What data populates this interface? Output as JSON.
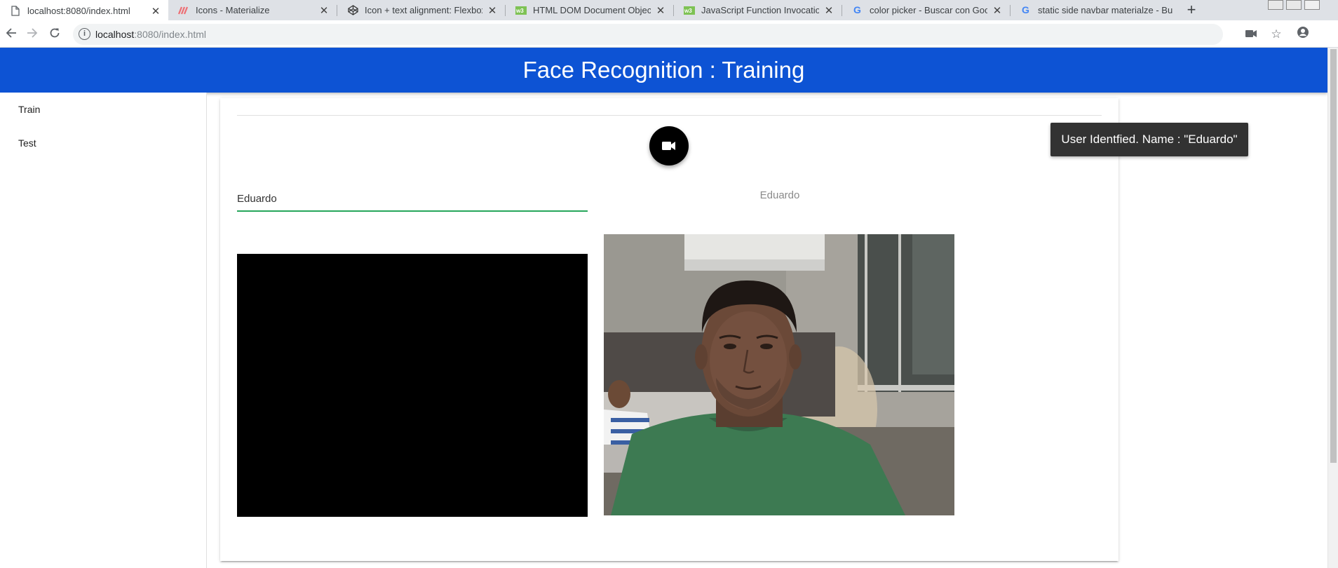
{
  "browser": {
    "tabs": [
      {
        "title": "localhost:8080/index.html",
        "icon": "page-icon",
        "active": true
      },
      {
        "title": "Icons - Materialize",
        "icon": "materialize-icon",
        "active": false
      },
      {
        "title": "Icon + text alignment: Flexbox",
        "icon": "codepen-icon",
        "active": false
      },
      {
        "title": "HTML DOM Document Objects",
        "icon": "w3schools-icon",
        "active": false
      },
      {
        "title": "JavaScript Function Invocation",
        "icon": "w3schools-icon",
        "active": false
      },
      {
        "title": "color picker - Buscar con Google",
        "icon": "google-icon",
        "active": false
      },
      {
        "title": "static side navbar materialze - Bu",
        "icon": "google-icon",
        "active": false
      }
    ],
    "url_host": "localhost",
    "url_rest": ":8080/index.html",
    "colors": {
      "tabstrip": "#dee1e6",
      "omnibox": "#f1f3f4"
    }
  },
  "page": {
    "title": "Face Recognition : Training",
    "nav_items": [
      {
        "label": "Train"
      },
      {
        "label": "Test"
      }
    ],
    "name_input_value": "Eduardo",
    "identified_label": "Eduardo",
    "camera_button_icon": "videocam-icon",
    "toast": "User Identfied. Name : \"Eduardo\"",
    "colors": {
      "appbar": "#0d53d4",
      "input_underline": "#26a65b",
      "toast_bg": "#323232",
      "fab_bg": "#000000"
    }
  }
}
